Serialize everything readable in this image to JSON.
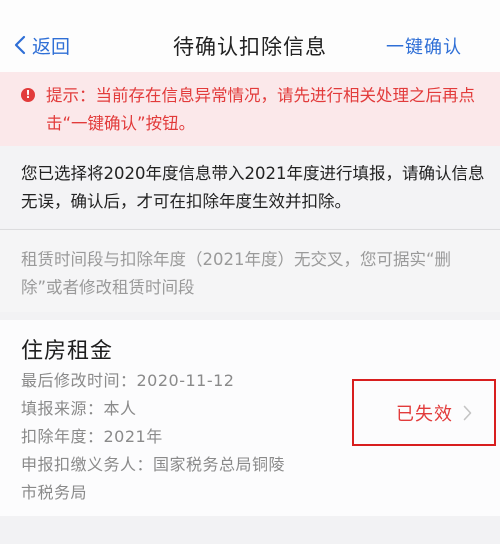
{
  "nav": {
    "back_label": "返回",
    "title": "待确认扣除信息",
    "action_label": "一键确认"
  },
  "alert": {
    "icon": "!",
    "text": "提示：当前存在信息异常情况，请先进行相关处理之后再点击“一键确认”按钮。"
  },
  "info": {
    "text": "您已选择将2020年度信息带入2021年度进行填报，请确认信息无误，确认后，才可在扣除年度生效并扣除。"
  },
  "note": {
    "text": "租赁时间段与扣除年度（2021年度）无交叉，您可据实“删除”或者修改租赁时间段"
  },
  "card": {
    "title": "住房租金",
    "last_modified": "最后修改时间：2020-11-12",
    "source": "填报来源：本人",
    "deduction_year": "扣除年度：2021年",
    "withholding_agent_line1": "申报扣缴义务人：国家税务总局铜陵",
    "withholding_agent_line2": "市税务局",
    "status": "已失效"
  },
  "colors": {
    "accent": "#2f6fd6",
    "error": "#e23b3b",
    "alert_bg": "#fbe8ea"
  }
}
